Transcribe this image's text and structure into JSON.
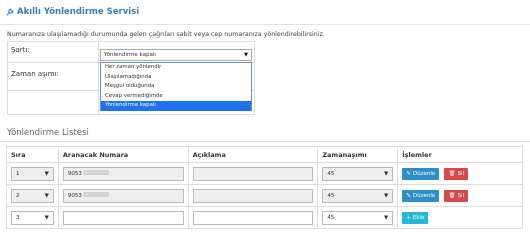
{
  "header": {
    "title": "Akıllı Yönlendirme Servisi"
  },
  "description": "Numaranıza ulaşılamadığı durumunda gelen çağrıları sabit veya cep numaranıza yönlendirebilirsiniz.",
  "condition": {
    "sart_label": "Şartı:",
    "timeout_label": "Zaman aşımı:",
    "selected": "Yönlendirme kapalı",
    "options": [
      "Her zaman yönlendir",
      "Ulaşılamadığında",
      "Meşgul olduğunda",
      "Cevap vermediğimde",
      "Yönlendirme kapalı"
    ]
  },
  "list": {
    "title": "Yönlendirme Listesi",
    "columns": [
      "Sıra",
      "Aranacak Numara",
      "Açıklama",
      "Zamanaşımı",
      "İşlemler"
    ],
    "rows": [
      {
        "order": "1",
        "number": "9053",
        "timeout": "45",
        "actions": [
          "Düzenle",
          "Sil"
        ]
      },
      {
        "order": "2",
        "number": "9053",
        "timeout": "45",
        "actions": [
          "Düzenle",
          "Sil"
        ]
      },
      {
        "order": "3",
        "number": "",
        "timeout": "45",
        "actions": [
          "Ekle"
        ]
      }
    ]
  },
  "colors": {
    "accent": "#3a7cbf",
    "edit": "#2d8ec9",
    "delete": "#d64a4a",
    "add": "#27b8d6"
  }
}
